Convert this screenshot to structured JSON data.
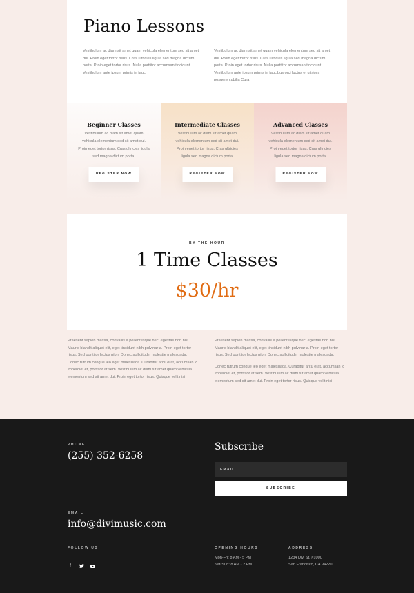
{
  "hero": {
    "title": "Piano Lessons",
    "col_left": "Vestibulum ac diam sit amet quam vehicula elementum sed sit amet dui. Proin eget tortor risus. Cras ultricies ligula sed magna dictum porta. Proin eget tortor risus. Nulla porttitor accumsan tincidunt. Vestibulum ante ipsum primis in fauci",
    "col_right": "Vestibulum ac diam sit amet quam vehicula elementum sed sit amet dui. Proin eget tortor risus. Cras ultricies ligula sed magna dictum porta. Proin eget tortor risus. Nulla porttitor accumsan tincidunt. Vestibulum ante ipsum primis in faucibus orci luctus et ultrices posuere cubilia Cura"
  },
  "classes": [
    {
      "title": "Beginner Classes",
      "text": "Vestibulum ac diam sit amet quam vehicula elementum sed sit amet dui. Proin eget tortor risus. Cras ultricies ligula sed magna dictum porta.",
      "button": "REGISTER NOW"
    },
    {
      "title": "Intermediate Classes",
      "text": "Vestibulum ac diam sit amet quam vehicula elementum sed sit amet dui. Proin eget tortor risus. Cras ultricies ligula sed magna dictum porta.",
      "button": "REGISTER NOW"
    },
    {
      "title": "Advanced Classes",
      "text": "Vestibulum ac diam sit amet quam vehicula elementum sed sit amet dui. Proin eget tortor risus. Cras ultricies ligula sed magna dictum porta.",
      "button": "REGISTER NOW"
    }
  ],
  "pricing": {
    "eyebrow": "BY THE HOUR",
    "title": "1 Time Classes",
    "price": "$30/hr",
    "price_color": "#e06b12"
  },
  "description": {
    "left": "Praesent sapien massa, convallis a pellentesque nec, egestas non nisi. Mauris blandit aliquet elit, eget tincidunt nibh pulvinar a. Proin eget tortor risus. Sed porttitor lectus nibh. Donec sollicitudin molestie malesuada. Donec rutrum congue leo eget malesuada. Curabitur arcu erat, accumsan id imperdiet et, porttitor at sem. Vestibulum ac diam sit amet quam vehicula elementum sed sit amet dui. Proin eget tortor risus. Quisque velit nisi",
    "right_p1": "Praesent sapien massa, convallis a pellentesque nec, egestas non nisi. Mauris blandit aliquet elit, eget tincidunt nibh pulvinar a. Proin eget tortor risus. Sed porttitor lectus nibh. Donec sollicitudin molestie malesuada.",
    "right_p2": "Donec rutrum congue leo eget malesuada. Curabitur arcu erat, accumsan id imperdiet et, porttitor at sem. Vestibulum ac diam sit amet quam vehicula elementum sed sit amet dui. Proin eget tortor risus. Quisque velit nisi"
  },
  "footer": {
    "phone_label": "PHONE",
    "phone": "(255) 352-6258",
    "email_label": "EMAIL",
    "email": "info@divimusic.com",
    "follow_label": "FOLLOW US",
    "social_icons": [
      "facebook-icon",
      "twitter-icon",
      "youtube-icon"
    ],
    "subscribe_title": "Subscribe",
    "email_placeholder": "EMAIL",
    "subscribe_button": "SUBSCRIBE",
    "hours_label": "OPENING HOURS",
    "hours_line1": "Mon-Fri: 8 AM - 5 PM",
    "hours_line2": "Sat-Sun: 8 AM - 2 PM",
    "address_label": "ADDRESS",
    "address_line1": "1234 Divi St. #1000",
    "address_line2": "San Francisco, CA 94220"
  }
}
